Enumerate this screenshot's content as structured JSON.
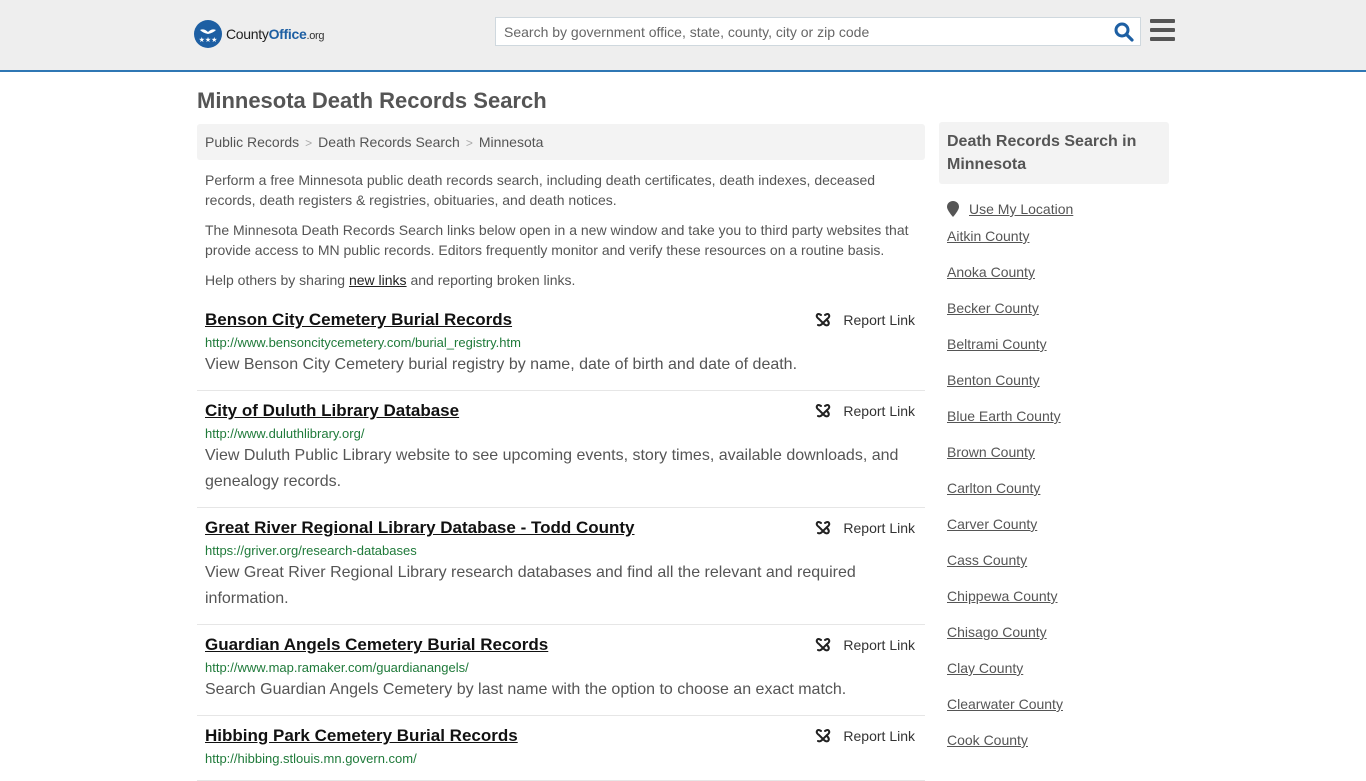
{
  "header": {
    "logo": {
      "brand_prefix": "County",
      "brand_main": "Office",
      "brand_suffix": ".org"
    },
    "search": {
      "placeholder": "Search by government office, state, county, city or zip code",
      "value": ""
    },
    "accent_color": "#2f77b4"
  },
  "page": {
    "title": "Minnesota Death Records Search"
  },
  "breadcrumb": [
    {
      "label": "Public Records"
    },
    {
      "label": "Death Records Search"
    },
    {
      "label": "Minnesota"
    }
  ],
  "breadcrumb_separator": ">",
  "intro": {
    "p1": "Perform a free Minnesota public death records search, including death certificates, death indexes, deceased records, death registers & registries, obituaries, and death notices.",
    "p2": "The Minnesota Death Records Search links below open in a new window and take you to third party websites that provide access to MN public records. Editors frequently monitor and verify these resources on a routine basis.",
    "p3_before": "Help others by sharing ",
    "p3_link": "new links",
    "p3_after": " and reporting broken links."
  },
  "results": [
    {
      "title": "Benson City Cemetery Burial Records",
      "url": "http://www.bensoncitycemetery.com/burial_registry.htm",
      "description": "View Benson City Cemetery burial registry by name, date of birth and date of death.",
      "report_label": "Report Link"
    },
    {
      "title": "City of Duluth Library Database",
      "url": "http://www.duluthlibrary.org/",
      "description": "View Duluth Public Library website to see upcoming events, story times, available downloads, and genealogy records.",
      "report_label": "Report Link"
    },
    {
      "title": "Great River Regional Library Database - Todd County",
      "url": "https://griver.org/research-databases",
      "description": "View Great River Regional Library research databases and find all the relevant and required information.",
      "report_label": "Report Link"
    },
    {
      "title": "Guardian Angels Cemetery Burial Records",
      "url": "http://www.map.ramaker.com/guardianangels/",
      "description": "Search Guardian Angels Cemetery by last name with the option to choose an exact match.",
      "report_label": "Report Link"
    },
    {
      "title": "Hibbing Park Cemetery Burial Records",
      "url": "http://hibbing.stlouis.mn.govern.com/",
      "description": "",
      "report_label": "Report Link"
    }
  ],
  "sidebar": {
    "heading": "Death Records Search in Minnesota",
    "use_location": "Use My Location",
    "counties": [
      "Aitkin County",
      "Anoka County",
      "Becker County",
      "Beltrami County",
      "Benton County",
      "Blue Earth County",
      "Brown County",
      "Carlton County",
      "Carver County",
      "Cass County",
      "Chippewa County",
      "Chisago County",
      "Clay County",
      "Clearwater County",
      "Cook County"
    ]
  }
}
